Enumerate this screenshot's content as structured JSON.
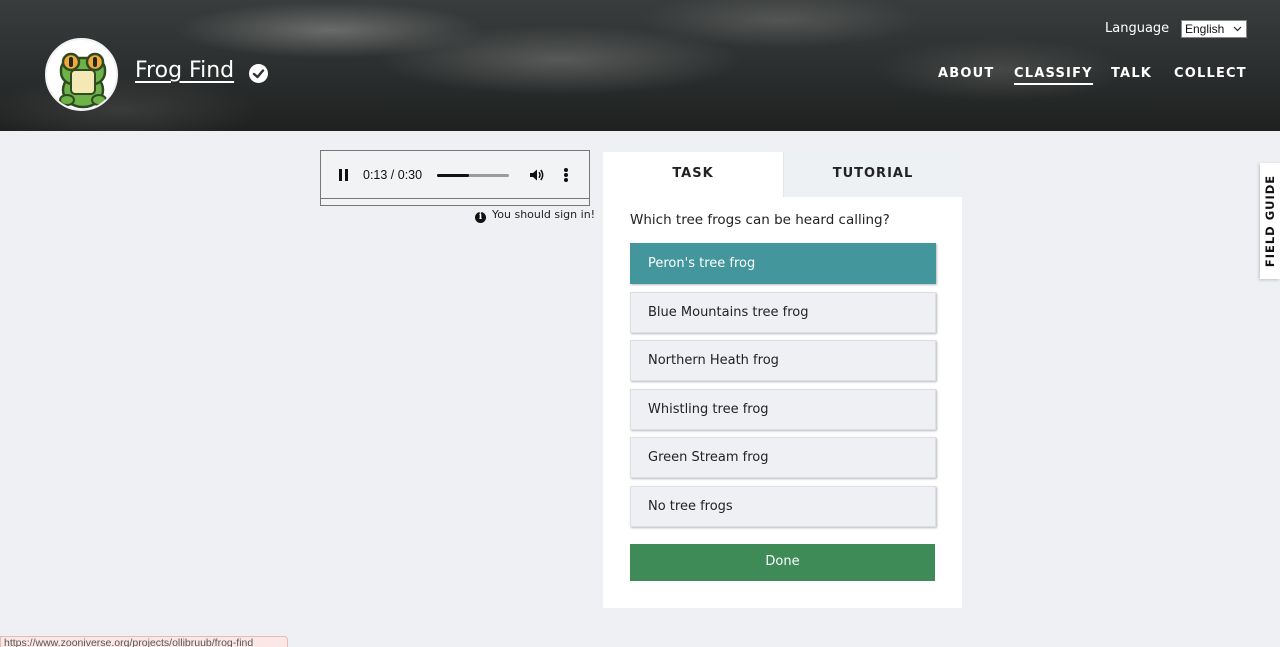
{
  "header": {
    "site_title": "Frog Find",
    "language_label": "Language",
    "language_value": "English",
    "nav": [
      {
        "label": "ABOUT",
        "active": false
      },
      {
        "label": "CLASSIFY",
        "active": true
      },
      {
        "label": "TALK",
        "active": false
      },
      {
        "label": "COLLECT",
        "active": false
      }
    ],
    "logo_icon": "frog-logo-icon",
    "verified_icon": "check-circle-icon"
  },
  "audio": {
    "time": "0:13 / 0:30",
    "progress": 0.45,
    "signin_notice": "You should sign in!"
  },
  "task": {
    "tabs": [
      "TASK",
      "TUTORIAL"
    ],
    "question": "Which tree frogs can be heard calling?",
    "answers": [
      {
        "label": "Peron's tree frog",
        "selected": true
      },
      {
        "label": "Blue Mountains tree frog",
        "selected": false
      },
      {
        "label": "Northern Heath frog",
        "selected": false
      },
      {
        "label": "Whistling tree frog",
        "selected": false
      },
      {
        "label": "Green Stream frog",
        "selected": false
      },
      {
        "label": "No tree frogs",
        "selected": false
      }
    ],
    "done_label": "Done"
  },
  "field_guide_label": "FIELD GUIDE",
  "status_url": "https://www.zooniverse.org/projects/ollibruub/frog-find",
  "colors": {
    "selected_answer": "#43969b",
    "done_button": "#3e8b57",
    "page_background": "#eff0f3"
  }
}
